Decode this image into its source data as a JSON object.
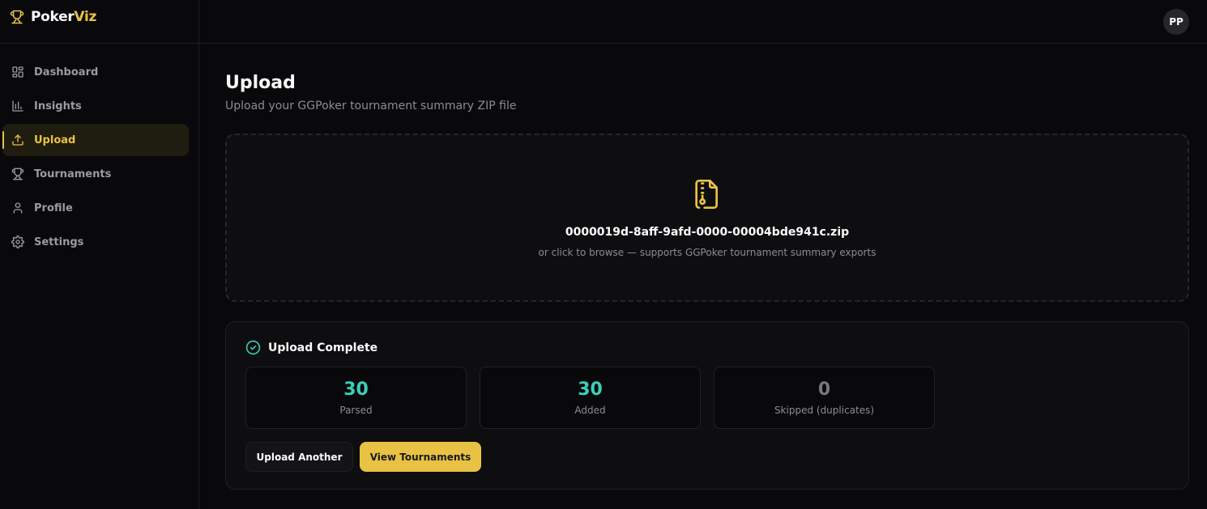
{
  "brand": {
    "name_part1": "Poker",
    "name_part2": "Viz",
    "accent": "#e9c244",
    "icon": "trophy-icon"
  },
  "sidebar": {
    "items": [
      {
        "label": "Dashboard",
        "icon": "grid-icon",
        "active": false
      },
      {
        "label": "Insights",
        "icon": "bar-chart-icon",
        "active": false
      },
      {
        "label": "Upload",
        "icon": "upload-icon",
        "active": true
      },
      {
        "label": "Tournaments",
        "icon": "trophy-icon",
        "active": false
      },
      {
        "label": "Profile",
        "icon": "user-icon",
        "active": false
      },
      {
        "label": "Settings",
        "icon": "gear-icon",
        "active": false
      }
    ]
  },
  "header": {
    "avatar_initials": "PP"
  },
  "page": {
    "title": "Upload",
    "subtitle": "Upload your GGPoker tournament summary ZIP file"
  },
  "dropzone": {
    "icon": "file-zip-icon",
    "filename": "0000019d-8aff-9afd-0000-00004bde941c.zip",
    "hint": "or click to browse — supports GGPoker tournament summary exports"
  },
  "result": {
    "icon": "check-circle-icon",
    "title": "Upload Complete",
    "stats": [
      {
        "value": "30",
        "label": "Parsed",
        "color": "#3ccfb8"
      },
      {
        "value": "30",
        "label": "Added",
        "color": "#3ccfb8"
      },
      {
        "value": "0",
        "label": "Skipped (duplicates)",
        "color": "#777780"
      }
    ],
    "buttons": {
      "secondary": "Upload Another",
      "primary": "View Tournaments"
    }
  }
}
